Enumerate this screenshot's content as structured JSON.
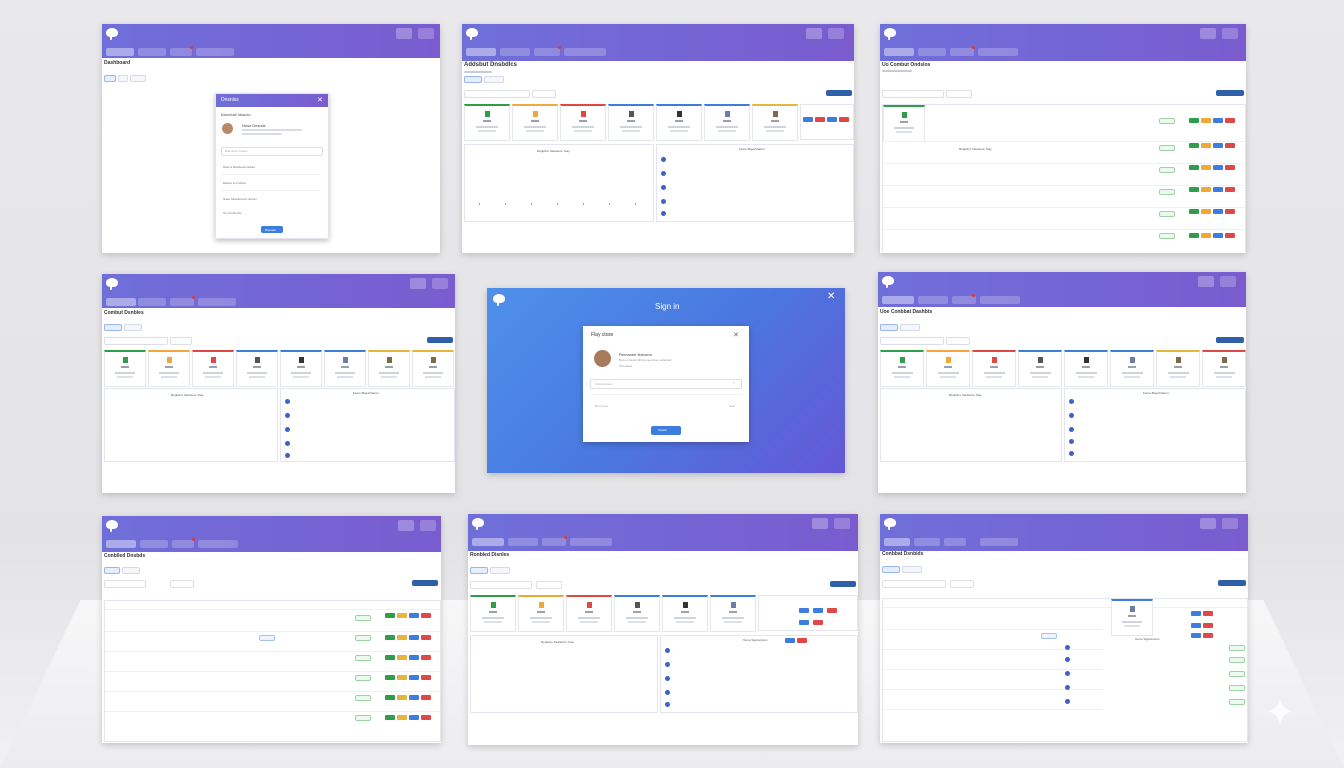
{
  "signin": {
    "title": "Sign in",
    "card_title": "Flay clsse",
    "user_name": "Remanee fineoma",
    "user_detail_1": "Bocos crastd dtlinost aerslrae tuclelslac",
    "user_detail_2": "Dlsrsasas",
    "field_1_placeholder": "Sonoe Iiosiw",
    "field_2_placeholder": "Bsrd Sost",
    "field_2_suffix": "Sost",
    "submit_label": "Toastit"
  },
  "dashboard_titles": {
    "top_left": "Dashboard",
    "top_middle": "Addsbut Dnsbdlcs",
    "top_right": "Uo Combut Ondslos",
    "mid_left": "Combut Dsnbles",
    "mid_right": "Uoe Conbbat Dashbts",
    "bot_left": "Conblled Dnsbds",
    "bot_middle": "Ronbled Disnles",
    "bot_right": "Conbbat Dsnblds"
  },
  "modal_small": {
    "title": "Dnsnlss",
    "header_label": "Basnhalt Idsaolo",
    "person_name": "Nnss Desrsle",
    "search_placeholder": "Bdsnerss Inoans",
    "item_1": "Rass a Basllueat lolasla",
    "item_2": "Basslo a Inmfdss",
    "item_3": "Nase bassllecoeb vilecan",
    "item_4": "So Uncbuolss",
    "button": "Bsqnast"
  },
  "sections": {
    "chart_title": "Reglsfrre Sauitsure Toay",
    "chart_title_alt": "Regtisne Seattasre Tnay",
    "list_title": "Feore Bigeshhasns",
    "list_title_alt": "Teure Signisntions",
    "add_button": "Lemeasebnls",
    "filter_label": "Fbdtnnrs",
    "tab_1": "Baskt Bb",
    "tab_2": "Bsanb Inmb"
  },
  "colors": {
    "header_start": "#6f6fd9",
    "header_end": "#7a5ccf",
    "signin_bg": "#4a82e6",
    "primary_button": "#3d7de0",
    "add_button": "#2f5fa8",
    "green": "#2e9e4a",
    "orange": "#f0a83a",
    "red": "#e04848"
  },
  "icons": [
    "elephant-logo-icon",
    "user-icon",
    "logout-icon",
    "close-icon",
    "search-icon",
    "filter-icon"
  ]
}
